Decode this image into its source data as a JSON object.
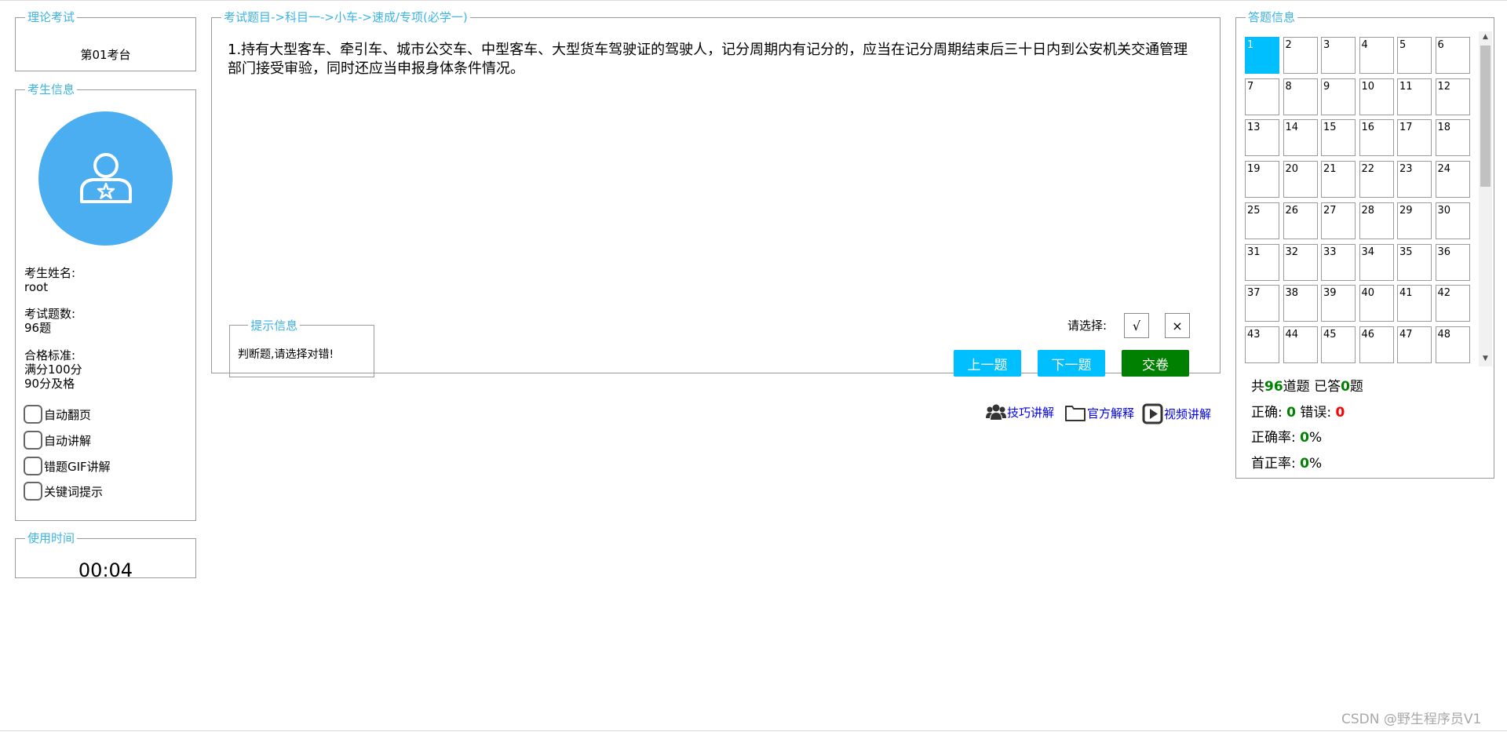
{
  "theory": {
    "legend": "理论考试",
    "seat": "第01考台"
  },
  "examinee": {
    "legend": "考生信息",
    "name_label": "考生姓名:",
    "name": "root",
    "count_label": "考试题数:",
    "count": "96题",
    "standard_label": "合格标准:",
    "standard_line1": "满分100分",
    "standard_line2": "90分及格",
    "options": [
      "自动翻页",
      "自动讲解",
      "错题GIF讲解",
      "关键词提示"
    ]
  },
  "timer": {
    "legend": "使用时间",
    "value": "00:04"
  },
  "question": {
    "legend": "考试题目->科目一->小车->速成/专项(必学一)",
    "text": "1.持有大型客车、牵引车、城市公交车、中型客车、大型货车驾驶证的驾驶人，记分周期内有记分的，应当在记分周期结束后三十日内到公安机关交通管理部门接受审验，同时还应当申报身体条件情况。",
    "tips_legend": "提示信息",
    "tips_text": "判断题,请选择对错!",
    "choose_label": "请选择:",
    "option_true": "√",
    "option_false": "×",
    "prev": "上一题",
    "next": "下一题",
    "submit": "交卷"
  },
  "helpers": {
    "skill": "技巧讲解",
    "official": "官方解释",
    "video": "视频讲解"
  },
  "answer": {
    "legend": "答题信息",
    "current": 1,
    "numbers": [
      1,
      2,
      3,
      4,
      5,
      6,
      7,
      8,
      9,
      10,
      11,
      12,
      13,
      14,
      15,
      16,
      17,
      18,
      19,
      20,
      21,
      22,
      23,
      24,
      25,
      26,
      27,
      28,
      29,
      30,
      31,
      32,
      33,
      34,
      35,
      36,
      37,
      38,
      39,
      40,
      41,
      42,
      43,
      44,
      45,
      46,
      47,
      48
    ],
    "total_prefix": "共",
    "total": "96",
    "total_mid": "道题 已答",
    "answered": "0",
    "total_suffix": "题",
    "correct_label": "正确:",
    "correct": "0",
    "wrong_label": "错误:",
    "wrong": "0",
    "rate_label": "正确率:",
    "rate": "0",
    "first_label": "首正率:",
    "first": "0",
    "percent": "%"
  },
  "colors": {
    "accent": "#3cb4e6",
    "button_blue": "#00bfff",
    "submit_green": "#008000",
    "avatar": "#4aaef1"
  },
  "watermark": "CSDN @野生程序员V1"
}
